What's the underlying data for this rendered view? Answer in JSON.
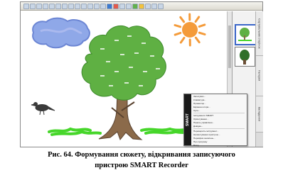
{
  "canvas": {
    "colors": {
      "cloud": "#8fa8e8",
      "sun": "#f49b3a",
      "foliage": "#5fb043",
      "trunk": "#8b6a4a",
      "grass": "#46d62a",
      "bird": "#3a3a3a",
      "leaf_label": "#ffffff"
    }
  },
  "menu": {
    "brand": "SMART",
    "items": [
      "Записувач...",
      "Клавіатура...",
      "Прожектор...",
      "Екранна штора...",
      "Лупа...",
      "Інструменти SMART",
      "Орієнтування...",
      "Панель управління...",
      "Довідка...",
      "Переверніть інструмент...",
      "Налаштування пристрою...",
      "Перевірка оновлень...",
      "Про програму",
      "Вихід"
    ]
  },
  "sidebar": {
    "tabs": [
      "Сортувальник сторінок",
      "Галерея",
      "Вкладення"
    ]
  },
  "caption": {
    "line1": "Рис. 64. Формування сюжету, відкривання записуючого",
    "line2": "пристрою SMART Recorder"
  }
}
